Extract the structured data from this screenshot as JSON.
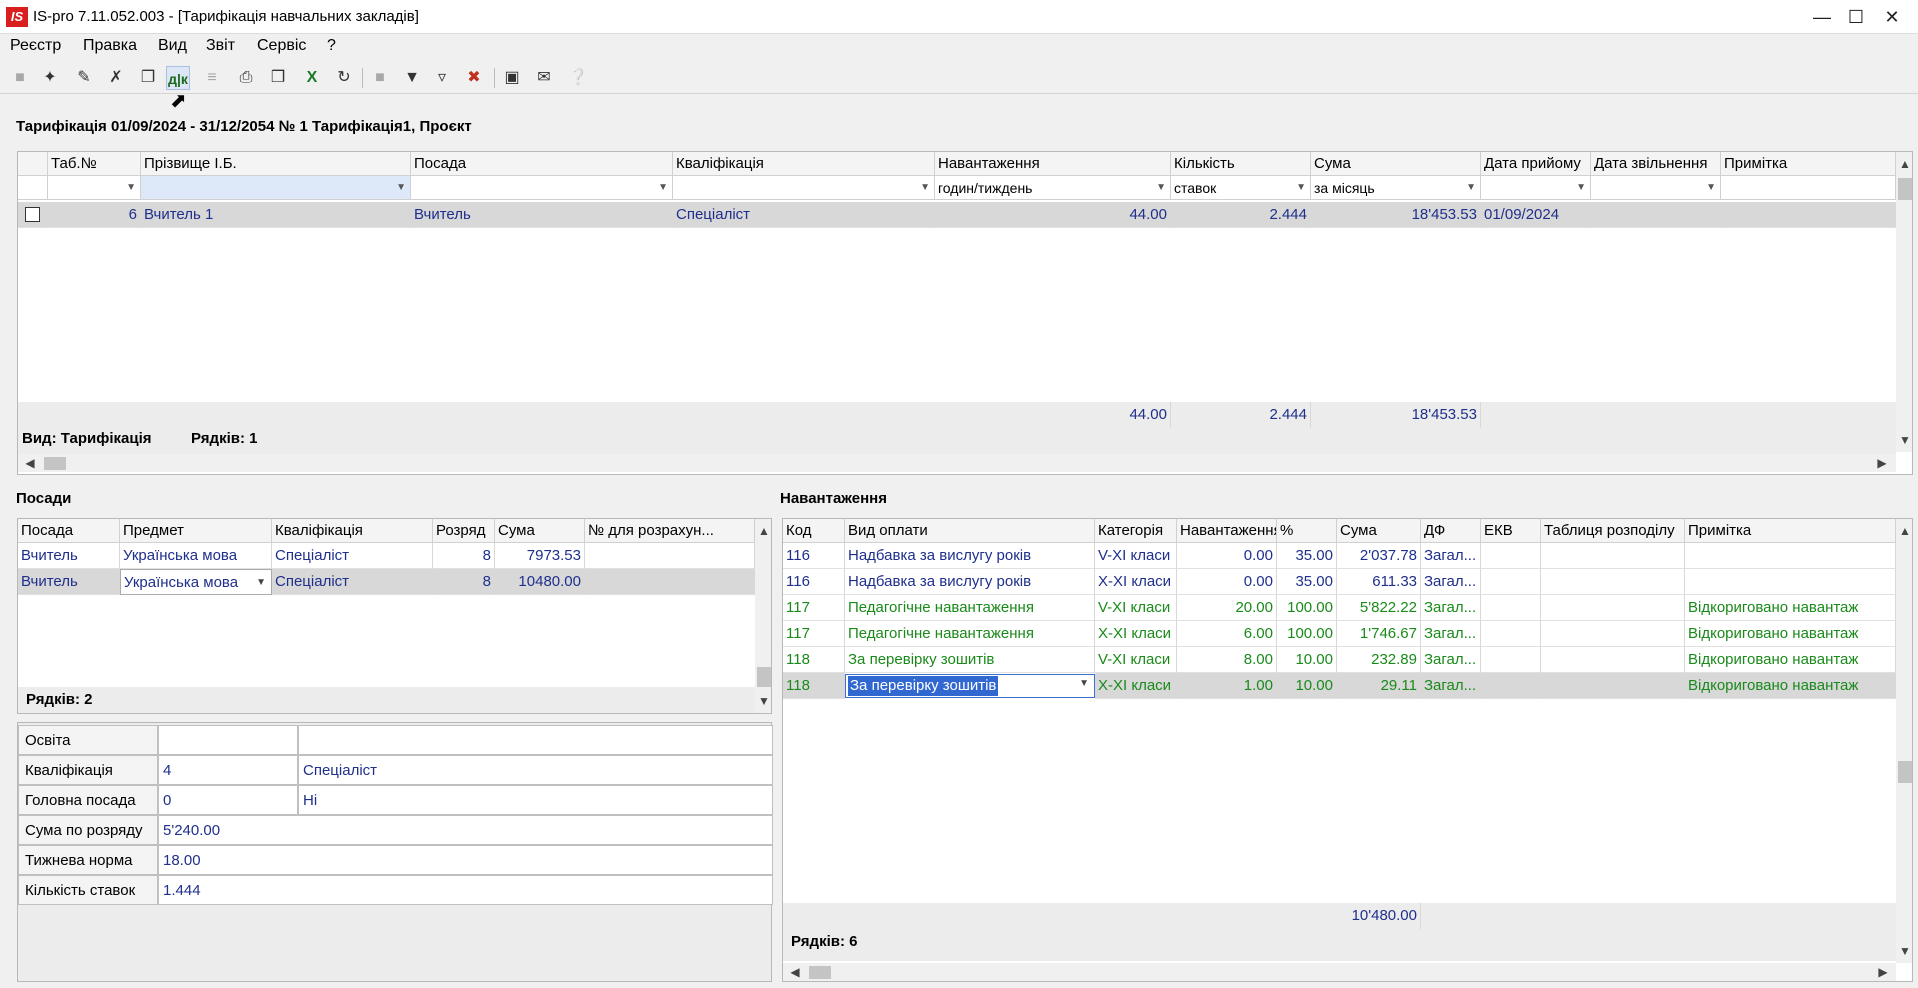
{
  "window": {
    "title": "IS-pro 7.11.052.003 - [Тарифікація навчальних закладів]",
    "logo": "IS"
  },
  "menu": [
    "Реєстр",
    "Правка",
    "Вид",
    "Звіт",
    "Сервіс",
    "?"
  ],
  "toolbar": {
    "dk_label": "д|к"
  },
  "doc_title": "Тарифікація 01/09/2024 - 31/12/2054 № 1 Тарифікація1, Проєкт",
  "main_grid": {
    "headers": [
      "Таб.№",
      "Прізвище І.Б.",
      "Посада",
      "Кваліфікація",
      "Навантаження",
      "Кількість",
      "Сума",
      "Дата прийому",
      "Дата звільнення",
      "Примітка"
    ],
    "filters": {
      "load": "годин/тиждень",
      "count": "ставок",
      "sum": "за місяць"
    },
    "rows": [
      {
        "tab": "6",
        "name": "Вчитель 1",
        "position": "Вчитель",
        "qualification": "Спеціаліст",
        "load": "44.00",
        "count": "2.444",
        "sum": "18'453.53",
        "hire_date": "01/09/2024",
        "fire_date": "",
        "note": ""
      }
    ],
    "totals": {
      "load": "44.00",
      "count": "2.444",
      "sum": "18'453.53"
    },
    "view_label": "Вид: Тарифікація",
    "rows_label": "Рядків: 1"
  },
  "positions": {
    "title": "Посади",
    "headers": [
      "Посада",
      "Предмет",
      "Кваліфікація",
      "Розряд",
      "Сума",
      "№ для розрахун..."
    ],
    "rows": [
      {
        "position": "Вчитель",
        "subject": "Українська мова",
        "qualification": "Спеціаліст",
        "grade": "8",
        "sum": "7973.53",
        "calc": ""
      },
      {
        "position": "Вчитель",
        "subject": "Українська мова",
        "qualification": "Спеціаліст",
        "grade": "8",
        "sum": "10480.00",
        "calc": ""
      }
    ],
    "rows_label": "Рядків: 2"
  },
  "props": [
    {
      "label": "Освіта",
      "val1": "",
      "val2": ""
    },
    {
      "label": "Кваліфікація",
      "val1": "4",
      "val2": "Спеціаліст"
    },
    {
      "label": "Головна посада",
      "val1": "0",
      "val2": "Ні"
    },
    {
      "label": "Сума по розряду",
      "val1": "5'240.00",
      "val2": ""
    },
    {
      "label": "Тижнева норма",
      "val1": "18.00",
      "val2": ""
    },
    {
      "label": "Кількість ставок",
      "val1": "1.444",
      "val2": ""
    }
  ],
  "load": {
    "title": "Навантаження",
    "headers": [
      "Код",
      "Вид оплати",
      "Категорія",
      "Навантаження",
      "%",
      "Сума",
      "ДФ",
      "ЕКВ",
      "Таблиця розподілу",
      "Примітка"
    ],
    "rows": [
      {
        "code": "116",
        "type": "Надбавка за вислугу років",
        "cat": "V-XI класи",
        "load": "0.00",
        "pct": "35.00",
        "sum": "2'037.78",
        "df": "Загал...",
        "ekv": "",
        "table": "",
        "note": ""
      },
      {
        "code": "116",
        "type": "Надбавка за вислугу років",
        "cat": "X-XI класи",
        "load": "0.00",
        "pct": "35.00",
        "sum": "611.33",
        "df": "Загал...",
        "ekv": "",
        "table": "",
        "note": ""
      },
      {
        "code": "117",
        "type": "Педагогічне навантаження",
        "cat": "V-XI класи",
        "load": "20.00",
        "pct": "100.00",
        "sum": "5'822.22",
        "df": "Загал...",
        "ekv": "",
        "table": "",
        "note": "Відкориговано навантаж"
      },
      {
        "code": "117",
        "type": "Педагогічне навантаження",
        "cat": "X-XI класи",
        "load": "6.00",
        "pct": "100.00",
        "sum": "1'746.67",
        "df": "Загал...",
        "ekv": "",
        "table": "",
        "note": "Відкориговано навантаж"
      },
      {
        "code": "118",
        "type": "За перевірку зошитів",
        "cat": "V-XI класи",
        "load": "8.00",
        "pct": "10.00",
        "sum": "232.89",
        "df": "Загал...",
        "ekv": "",
        "table": "",
        "note": "Відкориговано навантаж"
      },
      {
        "code": "118",
        "type": "За перевірку зошитів",
        "cat": "X-XI класи",
        "load": "1.00",
        "pct": "10.00",
        "sum": "29.11",
        "df": "Загал...",
        "ekv": "",
        "table": "",
        "note": "Відкориговано навантаж"
      }
    ],
    "total_sum": "10'480.00",
    "rows_label": "Рядків: 6"
  }
}
